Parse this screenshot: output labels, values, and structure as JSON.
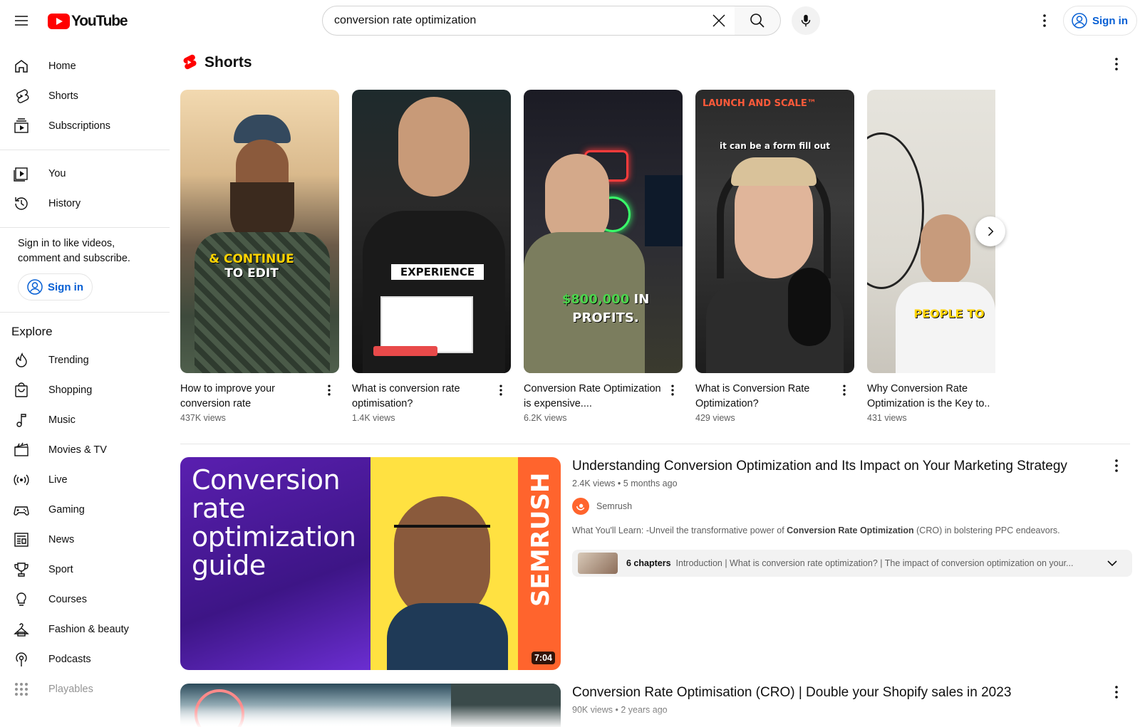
{
  "header": {
    "logo_text": "YouTube",
    "search_value": "conversion rate optimization",
    "signin_label": "Sign in"
  },
  "sidebar": {
    "main_items": [
      {
        "label": "Home",
        "icon": "home-icon"
      },
      {
        "label": "Shorts",
        "icon": "shorts-icon"
      },
      {
        "label": "Subscriptions",
        "icon": "subscriptions-icon"
      }
    ],
    "you_items": [
      {
        "label": "You",
        "icon": "you-icon"
      },
      {
        "label": "History",
        "icon": "history-icon"
      }
    ],
    "signin_prompt": "Sign in to like videos, comment and subscribe.",
    "signin_label": "Sign in",
    "explore_title": "Explore",
    "explore_items": [
      {
        "label": "Trending",
        "icon": "trending-icon"
      },
      {
        "label": "Shopping",
        "icon": "shopping-icon"
      },
      {
        "label": "Music",
        "icon": "music-icon"
      },
      {
        "label": "Movies & TV",
        "icon": "movies-icon"
      },
      {
        "label": "Live",
        "icon": "live-icon"
      },
      {
        "label": "Gaming",
        "icon": "gaming-icon"
      },
      {
        "label": "News",
        "icon": "news-icon"
      },
      {
        "label": "Sport",
        "icon": "sport-icon"
      },
      {
        "label": "Courses",
        "icon": "courses-icon"
      },
      {
        "label": "Fashion & beauty",
        "icon": "fashion-icon"
      },
      {
        "label": "Podcasts",
        "icon": "podcasts-icon"
      },
      {
        "label": "Playables",
        "icon": "playables-icon"
      }
    ]
  },
  "shorts": {
    "title": "Shorts",
    "items": [
      {
        "title": "How to improve your conversion rate",
        "views": "437K views",
        "overlay": "& CONTINUE\nTO EDIT"
      },
      {
        "title": "What is conversion rate optimisation?",
        "views": "1.4K views",
        "overlay": "EXPERIENCE"
      },
      {
        "title": "Conversion Rate Optimization is expensive....",
        "views": "6.2K views",
        "overlay": "$800,000 IN\nPROFITS."
      },
      {
        "title": "What is Conversion Rate Optimization?",
        "views": "429 views",
        "overlay": "LAUNCH AND SCALE™",
        "overlay2": "it can be a form fill out"
      },
      {
        "title": "Why Conversion Rate Optimization is the Key to..",
        "views": "431 views",
        "overlay": "PEOPLE TO"
      }
    ]
  },
  "video1": {
    "title": "Understanding Conversion Optimization and Its Impact on Your Marketing Strategy",
    "views": "2.4K views",
    "age": "5 months ago",
    "channel": "Semrush",
    "desc_prefix": "What You'll Learn: -Unveil the transformative power of ",
    "desc_bold": "Conversion Rate Optimization",
    "desc_suffix": " (CRO) in bolstering PPC endeavors.",
    "chapters_count": "6 chapters",
    "chapters_list": "Introduction | What is conversion rate optimization? | The impact of conversion optimization on your...",
    "duration": "7:04",
    "thumb_text": "Conversion rate optimization guide",
    "thumb_brand": "SEMRUSH"
  },
  "video2": {
    "title": "Conversion Rate Optimisation (CRO) | Double your Shopify sales in 2023",
    "views": "90K views",
    "age": "2 years ago"
  },
  "colors": {
    "brand_red": "#ff0000",
    "link_blue": "#065fd4",
    "semrush_orange": "#ff642d",
    "thumb_purple": "#4a1d9a",
    "thumb_yellow": "#ffe141"
  }
}
